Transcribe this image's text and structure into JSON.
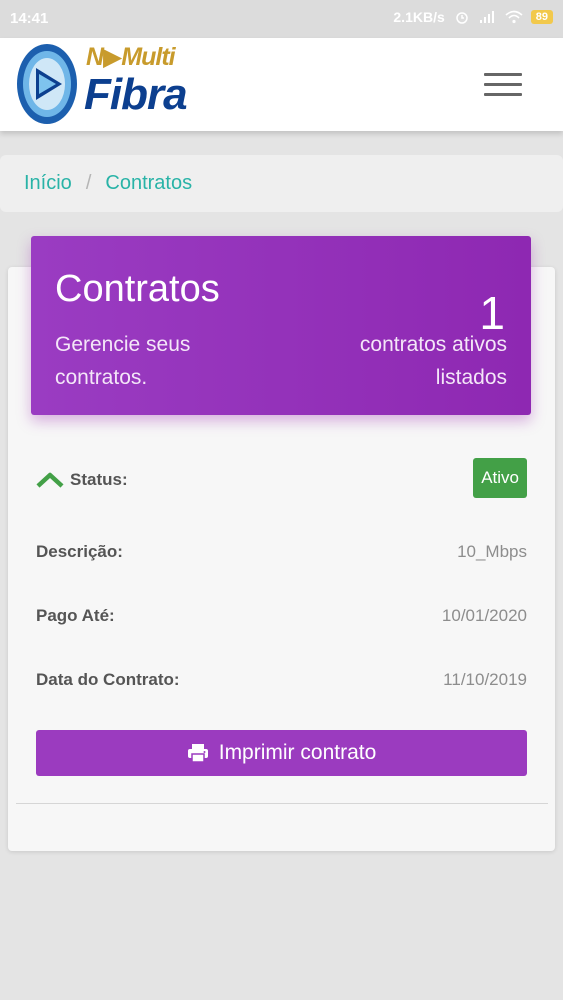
{
  "status_bar": {
    "time": "14:41",
    "speed": "2.1KB/s",
    "battery": "89",
    "icons": [
      "alarm-icon",
      "signal-icon",
      "wifi-icon",
      "battery-icon"
    ]
  },
  "header": {
    "logo_top": "N▶Multi",
    "logo_bottom": "Fibra",
    "menu_icon": "hamburger-icon"
  },
  "breadcrumb": {
    "home": "Início",
    "separator": "/",
    "current": "Contratos"
  },
  "summary": {
    "title": "Contratos",
    "subtitle": "Gerencie seus contratos.",
    "count": "1",
    "count_label": "contratos ativos listados"
  },
  "contract": {
    "status_label": "Status:",
    "status_value": "Ativo",
    "description_label": "Descrição:",
    "description_value": "10_Mbps",
    "paid_until_label": "Pago Até:",
    "paid_until_value": "10/01/2020",
    "contract_date_label": "Data do Contrato:",
    "contract_date_value": "11/10/2019",
    "print_label": "Imprimir contrato"
  },
  "colors": {
    "accent_purple": "#9b3bbf",
    "status_green": "#43a047",
    "link_teal": "#29b3a7"
  }
}
